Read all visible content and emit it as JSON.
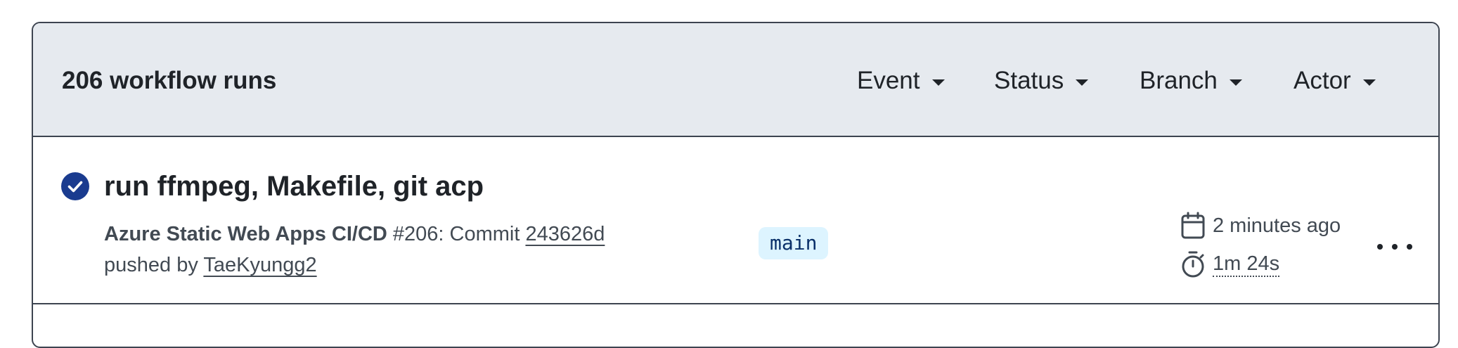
{
  "header": {
    "runs_count": "206 workflow runs",
    "filters": [
      {
        "label": "Event"
      },
      {
        "label": "Status"
      },
      {
        "label": "Branch"
      },
      {
        "label": "Actor"
      }
    ]
  },
  "runs": [
    {
      "status": "success",
      "title": "run ffmpeg, Makefile, git acp",
      "workflow_name": "Azure Static Web Apps CI/CD",
      "run_number": "#206",
      "commit_prefix": ": Commit ",
      "commit_sha": "243626d",
      "pushed_by_prefix": "pushed by ",
      "actor": "TaeKyungg2",
      "branch": "main",
      "created": "2 minutes ago",
      "duration": "1m 24s"
    }
  ],
  "colors": {
    "success": "#1a3b8f",
    "header_bg": "#e6eaef",
    "branch_bg": "#ddf4ff",
    "branch_text": "#0a3069"
  },
  "icons": {
    "status": "check-circle-icon",
    "calendar": "calendar-icon",
    "stopwatch": "stopwatch-icon",
    "menu": "kebab-horizontal-icon",
    "caret": "triangle-down-icon"
  }
}
